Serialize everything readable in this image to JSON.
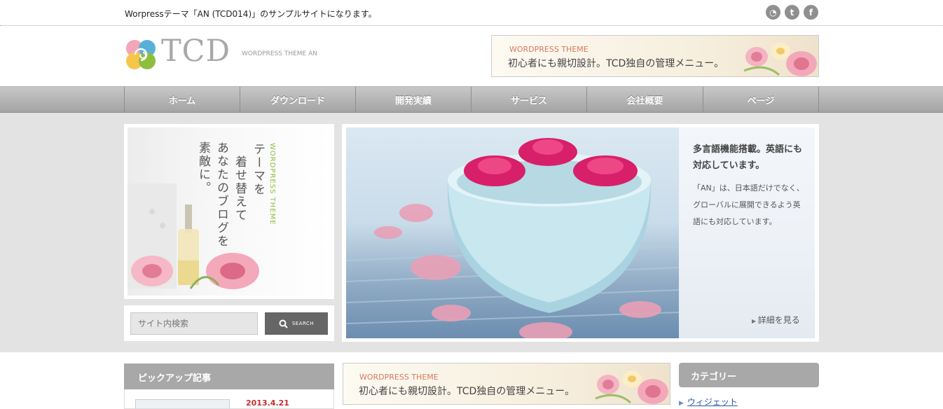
{
  "topbar": {
    "tagline": "Worpressテーマ「AN (TCD014)」のサンプルサイトになります。",
    "social": [
      {
        "name": "rss-icon",
        "glyph": "◔"
      },
      {
        "name": "twitter-icon",
        "glyph": "t"
      },
      {
        "name": "facebook-icon",
        "glyph": "f"
      }
    ]
  },
  "header": {
    "logo_text": "TCD",
    "logo_sub": "WORDPRESS THEME AN",
    "banner": {
      "label": "WORDPRESS THEME",
      "text": "初心者にも親切設計。TCD独自の管理メニュー。"
    }
  },
  "nav": {
    "items": [
      {
        "label": "ホーム"
      },
      {
        "label": "ダウンロード"
      },
      {
        "label": "開発実績"
      },
      {
        "label": "サービス"
      },
      {
        "label": "会社概要"
      },
      {
        "label": "ページ"
      }
    ]
  },
  "promo": {
    "lines": [
      "テーマを",
      "着せ替えて",
      "あなたのブログを",
      "素敵に。"
    ],
    "vertical_label": "WORDPRESS THEME"
  },
  "search": {
    "placeholder": "サイト内検索",
    "button_label": "SEARCH"
  },
  "slider": {
    "caption_title": "多言語機能搭載。英語にも対応しています。",
    "caption_body": "「AN」は、日本語だけでなく、グローバルに展開できるよう英語にも対応しています。",
    "more_label": "詳細を見る"
  },
  "pickup": {
    "title": "ピックアップ記事",
    "date": "2013.4.21"
  },
  "ad2": {
    "label": "WORDPRESS THEME",
    "text": "初心者にも親切設計。TCD独自の管理メニュー。"
  },
  "category": {
    "title": "カテゴリー",
    "items": [
      {
        "label": "ウィジェット"
      }
    ]
  },
  "colors": {
    "accent": "#d67a5e",
    "nav": "#a4a4a4",
    "date": "#c4302b",
    "link": "#2956a8",
    "logo_green": "#8dbe3f"
  }
}
